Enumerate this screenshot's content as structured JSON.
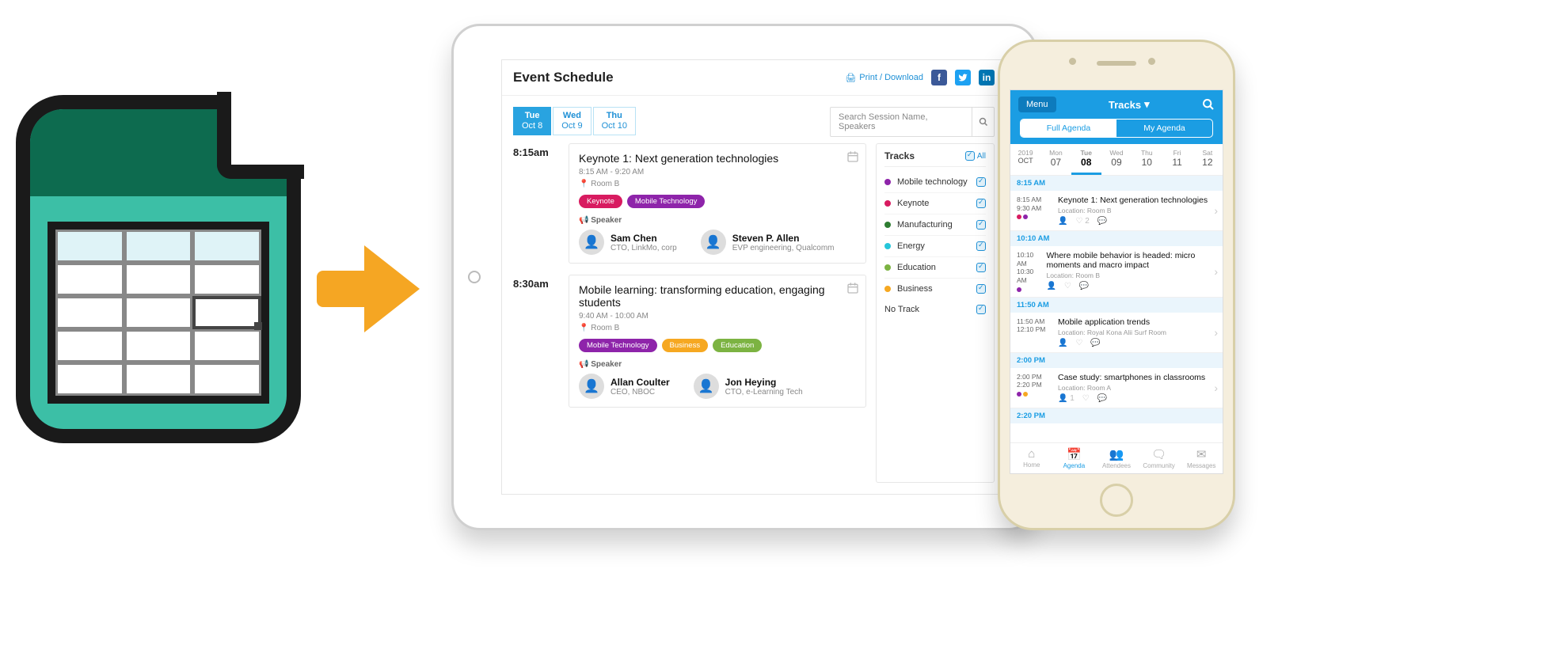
{
  "tablet": {
    "title": "Event Schedule",
    "print_label": "Print / Download",
    "search_placeholder": "Search Session Name, Speakers",
    "day_tabs": [
      {
        "dow": "Tue",
        "date": "Oct 8",
        "active": true
      },
      {
        "dow": "Wed",
        "date": "Oct 9",
        "active": false
      },
      {
        "dow": "Thu",
        "date": "Oct 10",
        "active": false
      }
    ],
    "slots": [
      {
        "time": "8:15am",
        "session": {
          "title": "Keynote 1: Next generation technologies",
          "meta": "8:15 AM - 9:20 AM",
          "location": "Room B",
          "tags": [
            {
              "label": "Keynote",
              "color": "#d81b60"
            },
            {
              "label": "Mobile Technology",
              "color": "#8e24aa"
            }
          ],
          "speaker_heading": "Speaker",
          "speakers": [
            {
              "name": "Sam Chen",
              "title": "CTO, LinkMo, corp"
            },
            {
              "name": "Steven P. Allen",
              "title": "EVP engineering, Qualcomm"
            }
          ]
        }
      },
      {
        "time": "8:30am",
        "session": {
          "title": "Mobile learning: transforming education, engaging students",
          "meta": "9:40 AM - 10:00 AM",
          "location": "Room B",
          "tags": [
            {
              "label": "Mobile Technology",
              "color": "#8e24aa"
            },
            {
              "label": "Business",
              "color": "#f6a821"
            },
            {
              "label": "Education",
              "color": "#7cb342"
            }
          ],
          "speaker_heading": "Speaker",
          "speakers": [
            {
              "name": "Allan Coulter",
              "title": "CEO, NBOC"
            },
            {
              "name": "Jon Heying",
              "title": "CTO, e-Learning Tech"
            }
          ]
        }
      }
    ],
    "tracks": {
      "heading": "Tracks",
      "all_label": "All",
      "items": [
        {
          "name": "Mobile technology",
          "color": "#8e24aa"
        },
        {
          "name": "Keynote",
          "color": "#d81b60"
        },
        {
          "name": "Manufacturing",
          "color": "#2e7d32"
        },
        {
          "name": "Energy",
          "color": "#26c6da"
        },
        {
          "name": "Education",
          "color": "#7cb342"
        },
        {
          "name": "Business",
          "color": "#f6a821"
        }
      ],
      "no_track_label": "No Track"
    }
  },
  "phone": {
    "menu_label": "Menu",
    "title": "Tracks",
    "segments": {
      "full": "Full Agenda",
      "my": "My Agenda"
    },
    "year_label": "2019",
    "month_label": "OCT",
    "days": [
      {
        "dow": "Mon",
        "num": "07"
      },
      {
        "dow": "Tue",
        "num": "08",
        "selected": true
      },
      {
        "dow": "Wed",
        "num": "09"
      },
      {
        "dow": "Thu",
        "num": "10"
      },
      {
        "dow": "Fri",
        "num": "11"
      },
      {
        "dow": "Sat",
        "num": "12"
      }
    ],
    "groups": [
      {
        "label": "8:15 AM",
        "items": [
          {
            "start": "8:15 AM",
            "end": "9:30 AM",
            "title": "Keynote 1: Next generation technologies",
            "location": "Location: Room B",
            "dots": [
              "#d81b60",
              "#8e24aa"
            ],
            "like_count": "2"
          }
        ]
      },
      {
        "label": "10:10 AM",
        "items": [
          {
            "start": "10:10 AM",
            "end": "10:30 AM",
            "title": "Where mobile behavior is headed: micro moments and macro impact",
            "location": "Location: Room B",
            "dots": [
              "#8e24aa"
            ]
          }
        ]
      },
      {
        "label": "11:50 AM",
        "items": [
          {
            "start": "11:50 AM",
            "end": "12:10 PM",
            "title": "Mobile application trends",
            "location": "Location: Royal Kona Alii Surf Room",
            "dots": []
          }
        ]
      },
      {
        "label": "2:00 PM",
        "items": [
          {
            "start": "2:00 PM",
            "end": "2:20 PM",
            "title": "Case study: smartphones in classrooms",
            "location": "Location: Room A",
            "dots": [
              "#8e24aa",
              "#f6a821"
            ],
            "att_count": "1"
          }
        ]
      },
      {
        "label": "2:20 PM",
        "items": []
      }
    ],
    "nav": [
      {
        "label": "Home"
      },
      {
        "label": "Agenda",
        "active": true
      },
      {
        "label": "Attendees"
      },
      {
        "label": "Community"
      },
      {
        "label": "Messages"
      }
    ]
  }
}
